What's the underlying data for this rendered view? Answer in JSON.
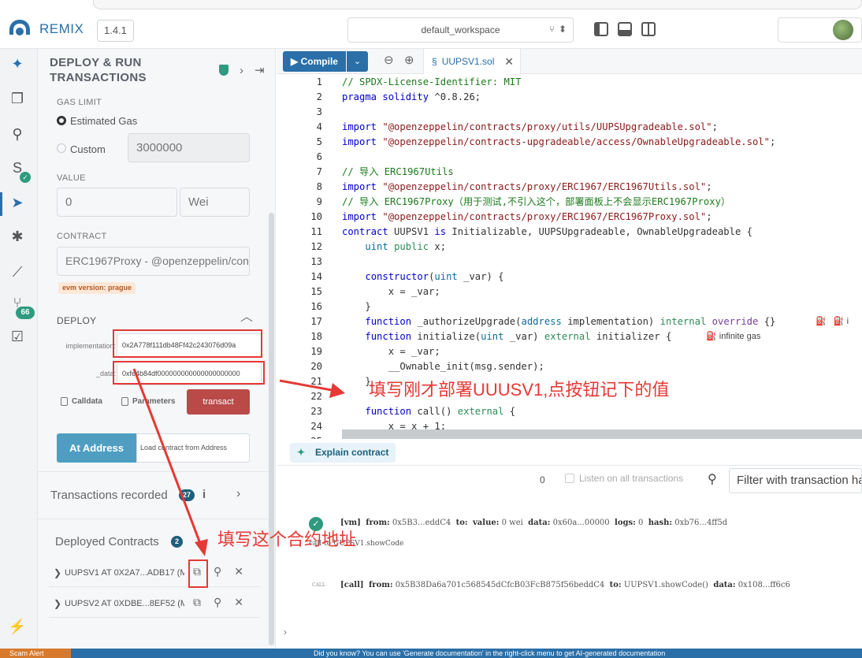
{
  "app": {
    "name": "REMIX",
    "version": "1.4.1",
    "workspace": "default_workspace"
  },
  "icon_bar": {
    "git_badge": "66"
  },
  "panel": {
    "title_line1": "DEPLOY & RUN",
    "title_line2": "TRANSACTIONS",
    "gas_limit_label": "GAS LIMIT",
    "estimated_gas_label": "Estimated Gas",
    "custom_label": "Custom",
    "custom_gas_value": "3000000",
    "value_label": "VALUE",
    "value_amount": "0",
    "value_unit": "Wei",
    "contract_label": "CONTRACT",
    "contract_selected": "ERC1967Proxy - @openzeppelin/con",
    "evm_badge": "evm version: prague",
    "deploy_label": "DEPLOY",
    "implementation_label": "implementation:",
    "implementation_value": "0x2A778f111db48Ff42c243076d09a",
    "data_label": "_data:",
    "data_value": "0xfe4b84df000000000000000000000",
    "calldata_label": "Calldata",
    "parameters_label": "Parameters",
    "transact_label": "transact",
    "at_address_label": "At Address",
    "load_contract_placeholder": "Load contract from Address",
    "transactions_recorded_label": "Transactions recorded",
    "transactions_recorded_count": "27",
    "deployed_contracts_label": "Deployed Contracts",
    "deployed_contracts_count": "2",
    "deployed": [
      {
        "name": "UUPSV1 AT 0X2A7...ADB17 (MEMORY)"
      },
      {
        "name": "UUPSV2 AT 0XDBE...8EF52 (MEMORY)"
      }
    ]
  },
  "editor": {
    "compile_label": "Compile",
    "file_tab": "UUPSV1.sol",
    "line_numbers": [
      "1",
      "2",
      "3",
      "4",
      "5",
      "6",
      "7",
      "8",
      "9",
      "10",
      "11",
      "12",
      "13",
      "14",
      "15",
      "16",
      "17",
      "18",
      "19",
      "20",
      "21",
      "22",
      "23",
      "24",
      "25"
    ],
    "lines": [
      "// SPDX-License-Identifier: MIT",
      "pragma solidity ^0.8.26;",
      "",
      "import \"@openzeppelin/contracts/proxy/utils/UUPSUpgradeable.sol\";",
      "import \"@openzeppelin/contracts-upgradeable/access/OwnableUpgradeable.sol\";",
      "",
      "// 导入 ERC1967Utils",
      "import \"@openzeppelin/contracts/proxy/ERC1967/ERC1967Utils.sol\";",
      "// 导入 ERC1967Proxy（用于测试,不引入这个，部署面板上不会显示ERC1967Proxy）",
      "import \"@openzeppelin/contracts/proxy/ERC1967/ERC1967Proxy.sol\";",
      "contract UUPSV1 is Initializable, UUPSUpgradeable, OwnableUpgradeable {",
      "    uint public x;",
      "",
      "    constructor(uint _var) {",
      "        x = _var;",
      "    }",
      "    function _authorizeUpgrade(address implementation) internal override {}",
      "    function initialize(uint _var) external initializer {",
      "        x = _var;",
      "        __Ownable_init(msg.sender);",
      "    }",
      "",
      "    function call() external {",
      "        x = x + 1;",
      "    }"
    ],
    "gas_hint": "infinite gas",
    "gas_hint_short": "i"
  },
  "terminal": {
    "explain_label": "Explain contract",
    "count": "0",
    "listen_label": "Listen on all transactions",
    "filter_placeholder": "Filter with transaction hash or address",
    "log1_tag": "[vm]",
    "log1_from": "from:",
    "log1_from_val": "0x5B3...eddC4",
    "log1_to": "to:",
    "log1_value": "value:",
    "log1_value_val": "0 wei",
    "log1_data": "data:",
    "log1_data_val": "0x60a...00000",
    "log1_logs": "logs:",
    "log1_logs_val": "0",
    "log1_hash": "hash:",
    "log1_hash_val": "0xb76...4ff5d",
    "log1_sub": "call to UUPSV1.showCode",
    "log2_tag_small": "CALL",
    "log2_tag": "[call]",
    "log2_from": "from:",
    "log2_from_val": "0x5B38Da6a701c568545dCfcB03FcB875f56beddC4",
    "log2_to": "to:",
    "log2_to_val": "UUPSV1.showCode()",
    "log2_data": "data:",
    "log2_data_val": "0x108...ff6c6"
  },
  "status": {
    "left": "Scam Alert",
    "message": "Did you know?  You can use 'Generate documentation' in the right-click menu to get AI-generated documentation"
  },
  "annotations": {
    "arrow_text": "填写刚才部署UUUSV1,点按钮记下的值",
    "address_text": "填写这个合约地址",
    "color": "#e53935"
  }
}
